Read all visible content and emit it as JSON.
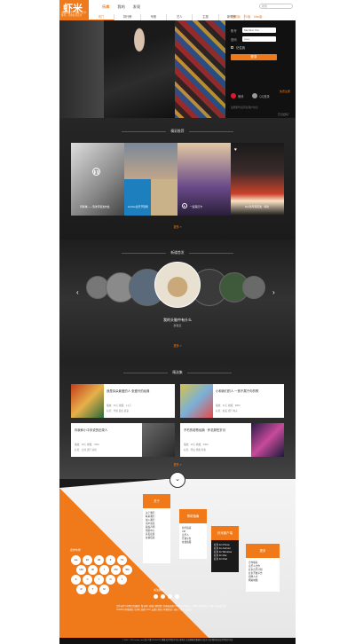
{
  "header": {
    "logo_text": "虾米",
    "logo_tagline": "高品质音乐，发现 · 分享 · 推荐，尽在虾米音乐",
    "nav": [
      "乐库",
      "我的",
      "发现"
    ],
    "search_placeholder": "搜索",
    "subnav": [
      "热门",
      "排行榜",
      "专辑",
      "艺人",
      "主题",
      "新歌榜"
    ],
    "clients": [
      "手机版",
      "PC版",
      "Mac版"
    ]
  },
  "login": {
    "account_label": "账号",
    "account_value": "Member You",
    "password_label": "密码",
    "password_value": "••••••",
    "remember": "记住我",
    "submit": "登录",
    "register": "免费注册",
    "weibo": "微博",
    "qq": "QQ登录",
    "agree": "注册即代表同意用户协议",
    "forgot": "忘记密码？"
  },
  "section_hot": {
    "title": "精彩推荐",
    "cards": [
      {
        "caption": "邓紫棋——泡沫专辑发布会"
      },
      {
        "caption": "Hi-Five音乐节现场"
      },
      {
        "caption": "一起来打卡"
      },
      {
        "caption": "Ryu新专辑首发 · 嘻哈"
      }
    ],
    "more": "更多 »"
  },
  "section_radio": {
    "title": "新碟首发",
    "current_title": "我的头脑中有什么",
    "current_artist": "群星集",
    "more": "更多 »"
  },
  "section_collect": {
    "title": "精选集",
    "items": [
      {
        "title": "我是耳朵最爱的人 张爱玲的经典",
        "meta": "播放：36万  收藏：1.2万",
        "tags": "标签：华语 民谣 摇滚"
      },
      {
        "title": "小和我们的人 一首不属于你的歌",
        "meta": "播放：32万  收藏：9800",
        "tags": "标签：欧美 流行 电子"
      },
      {
        "title": "你我和小中未说的旧录人",
        "meta": "播放：28万  收藏：7600",
        "tags": "标签：日韩 流行 清新"
      },
      {
        "title": "不朽的老歌经典 · 怀念那些岁月",
        "meta": "播放：25万  收藏：6400",
        "tags": "标签：怀旧 经典 老歌"
      }
    ],
    "more": "更多 »"
  },
  "footer": {
    "partners_label": "合作伙伴",
    "col1": {
      "head": "关于",
      "items": [
        "关于我们",
        "联系我们",
        "加入我们",
        "用户协议",
        "版权声明",
        "帮助中心",
        "意见反馈",
        "友情链接"
      ]
    },
    "col2": {
      "head": "帮助指南",
      "items": [
        "新手指南",
        "VIP",
        "音乐人",
        "开放平台",
        "在线客服"
      ]
    },
    "col3": {
      "head": "虾米客户端",
      "items": [
        "虾米 for iPhone",
        "虾米 for Android",
        "虾米 for Windows",
        "虾米 for Mac",
        "虾米 for iPad"
      ]
    },
    "col4": {
      "head": "更多",
      "items": [
        "合作联系",
        "音乐人合作",
        "虾米音乐计划",
        "虾米开放平台",
        "招聘人才",
        "网站地图"
      ]
    },
    "follow": "关注我们",
    "links": "合作伙伴 | 阿里巴巴集团 | 淘宝网 | 天猫 | 聚划算 | 全球速卖通 | 阿里巴巴国际站 | 1688 | 阿里妈妈 | 飞猪 | 阿里云计算 | YunOS | 阿里通信 | 万网 | 高德 | UC | 友盟 | 虾米 | 阿里影业 | 来往 | 钉钉 | 支付宝",
    "copyright": "© 2007 - 2014 xiami.com 浙ICP备1234567号 网络文化经营许可证 浙网文 信息网络传播视听节目许可证 增值电信业务经营许可证"
  },
  "partner_logos": [
    "tea",
    "ICI",
    "VR",
    "Z",
    "YS",
    "UM",
    "ID",
    "7",
    "FM",
    "SM",
    "S",
    "C",
    "Y",
    "N",
    "J",
    "R",
    "T",
    "M"
  ]
}
